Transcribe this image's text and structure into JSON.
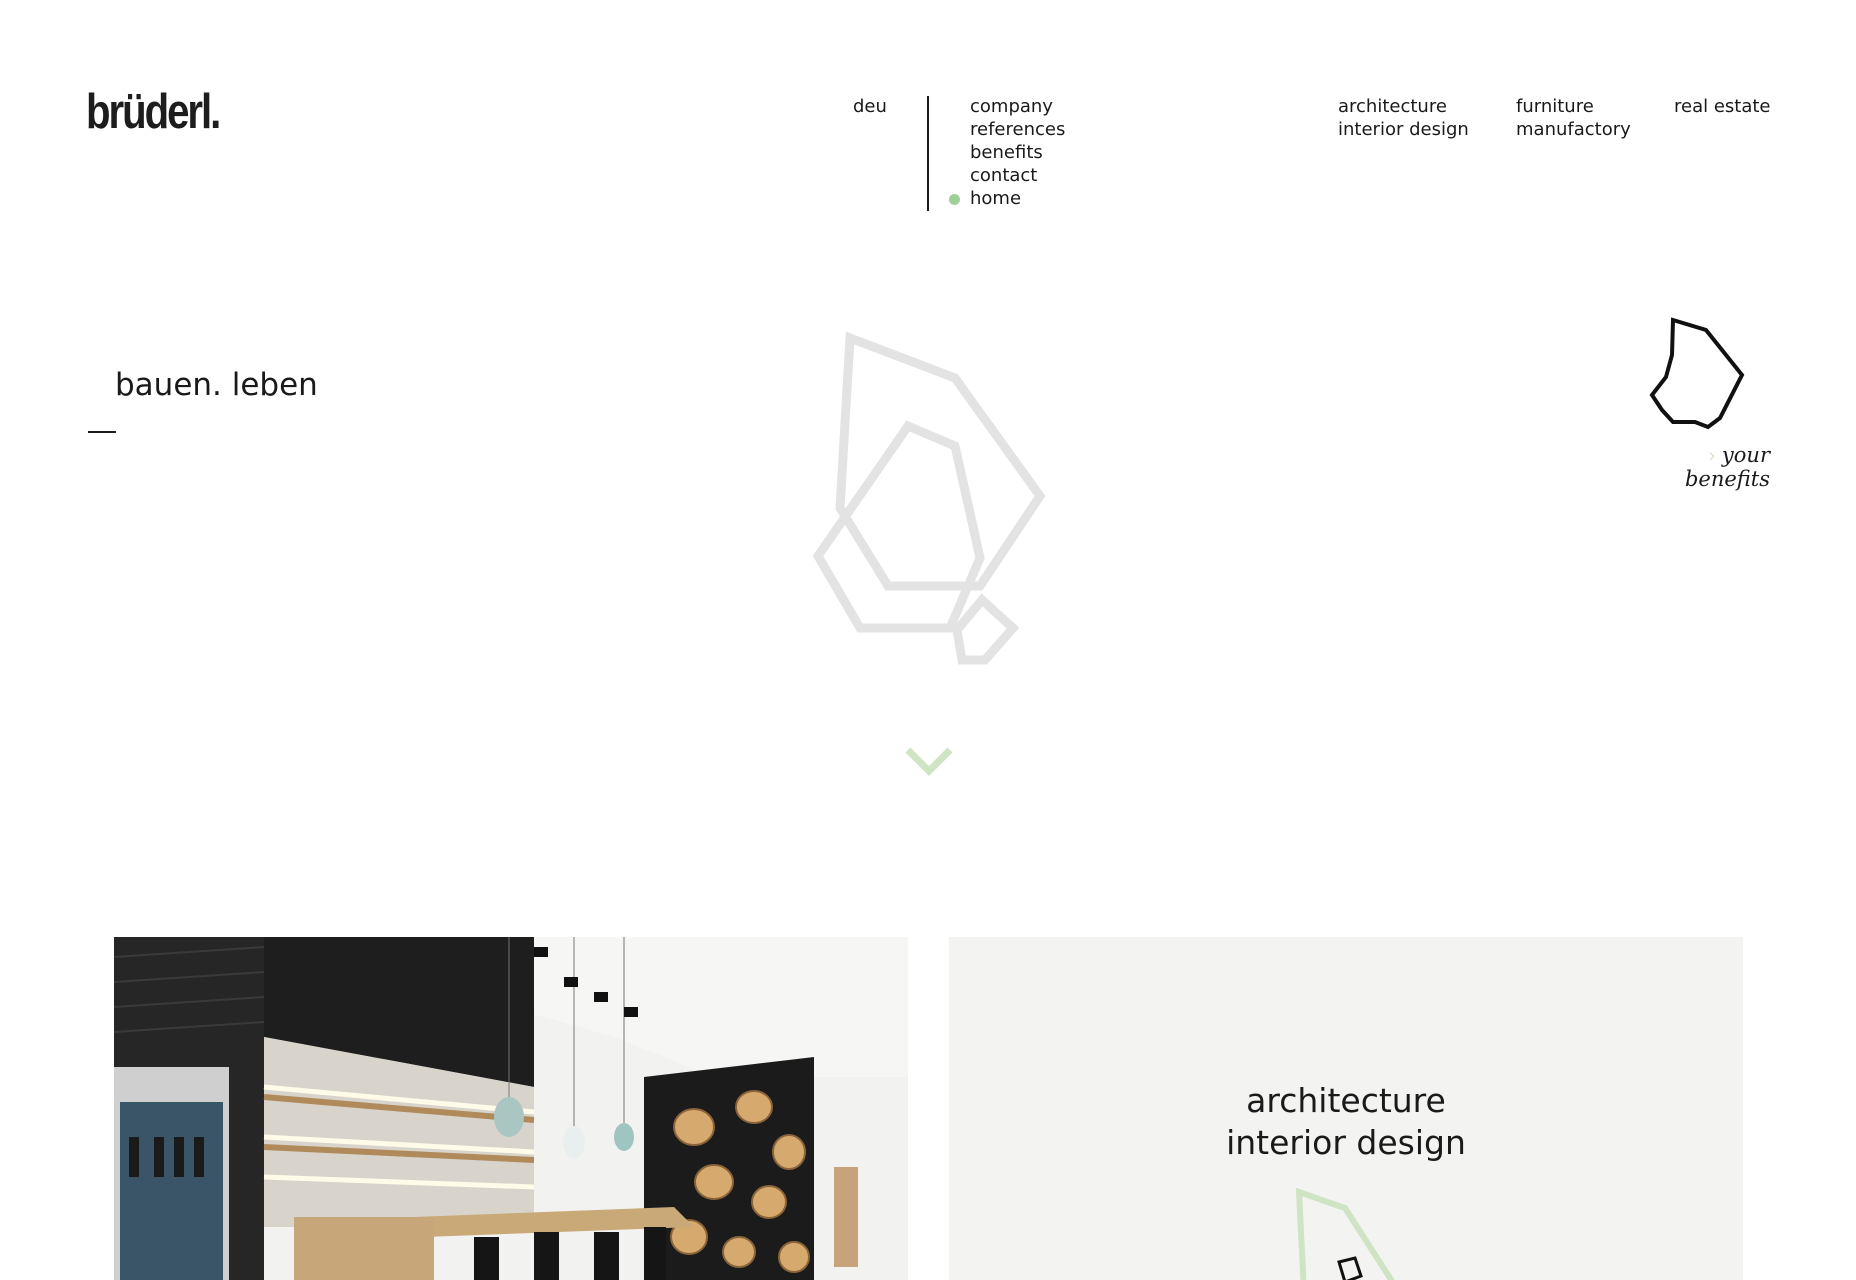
{
  "brand": {
    "logo_text": "brüderl."
  },
  "header": {
    "language": "deu",
    "nav_items": [
      {
        "label": "company",
        "active": false
      },
      {
        "label": "references",
        "active": false
      },
      {
        "label": "benefits",
        "active": false
      },
      {
        "label": "contact",
        "active": false
      },
      {
        "label": "home",
        "active": true
      }
    ],
    "domains": [
      {
        "line1": "architecture",
        "line2": "interior design"
      },
      {
        "line1": "furniture",
        "line2": "manufactory"
      },
      {
        "line1": "real estate",
        "line2": ""
      }
    ]
  },
  "hero": {
    "tagline": "bauen. leben",
    "mark_icon": "rock-outline-mark",
    "scroll_icon": "chevron-down-icon"
  },
  "benefits_link": {
    "arrow": "›",
    "line1": "your",
    "line2": "benefits",
    "icon": "rock-outline-icon"
  },
  "cards": [
    {
      "type": "photo",
      "alt_icon": "interior-photo"
    },
    {
      "type": "text",
      "title_line1": "architecture",
      "title_line2": "interior design",
      "icon": "rock-outline-icon"
    }
  ],
  "colors": {
    "accent_green": "#9fcf98",
    "light_green": "#cfe4c2",
    "mark_gray": "#e3e3e3",
    "card_bg": "#f3f3f2"
  }
}
